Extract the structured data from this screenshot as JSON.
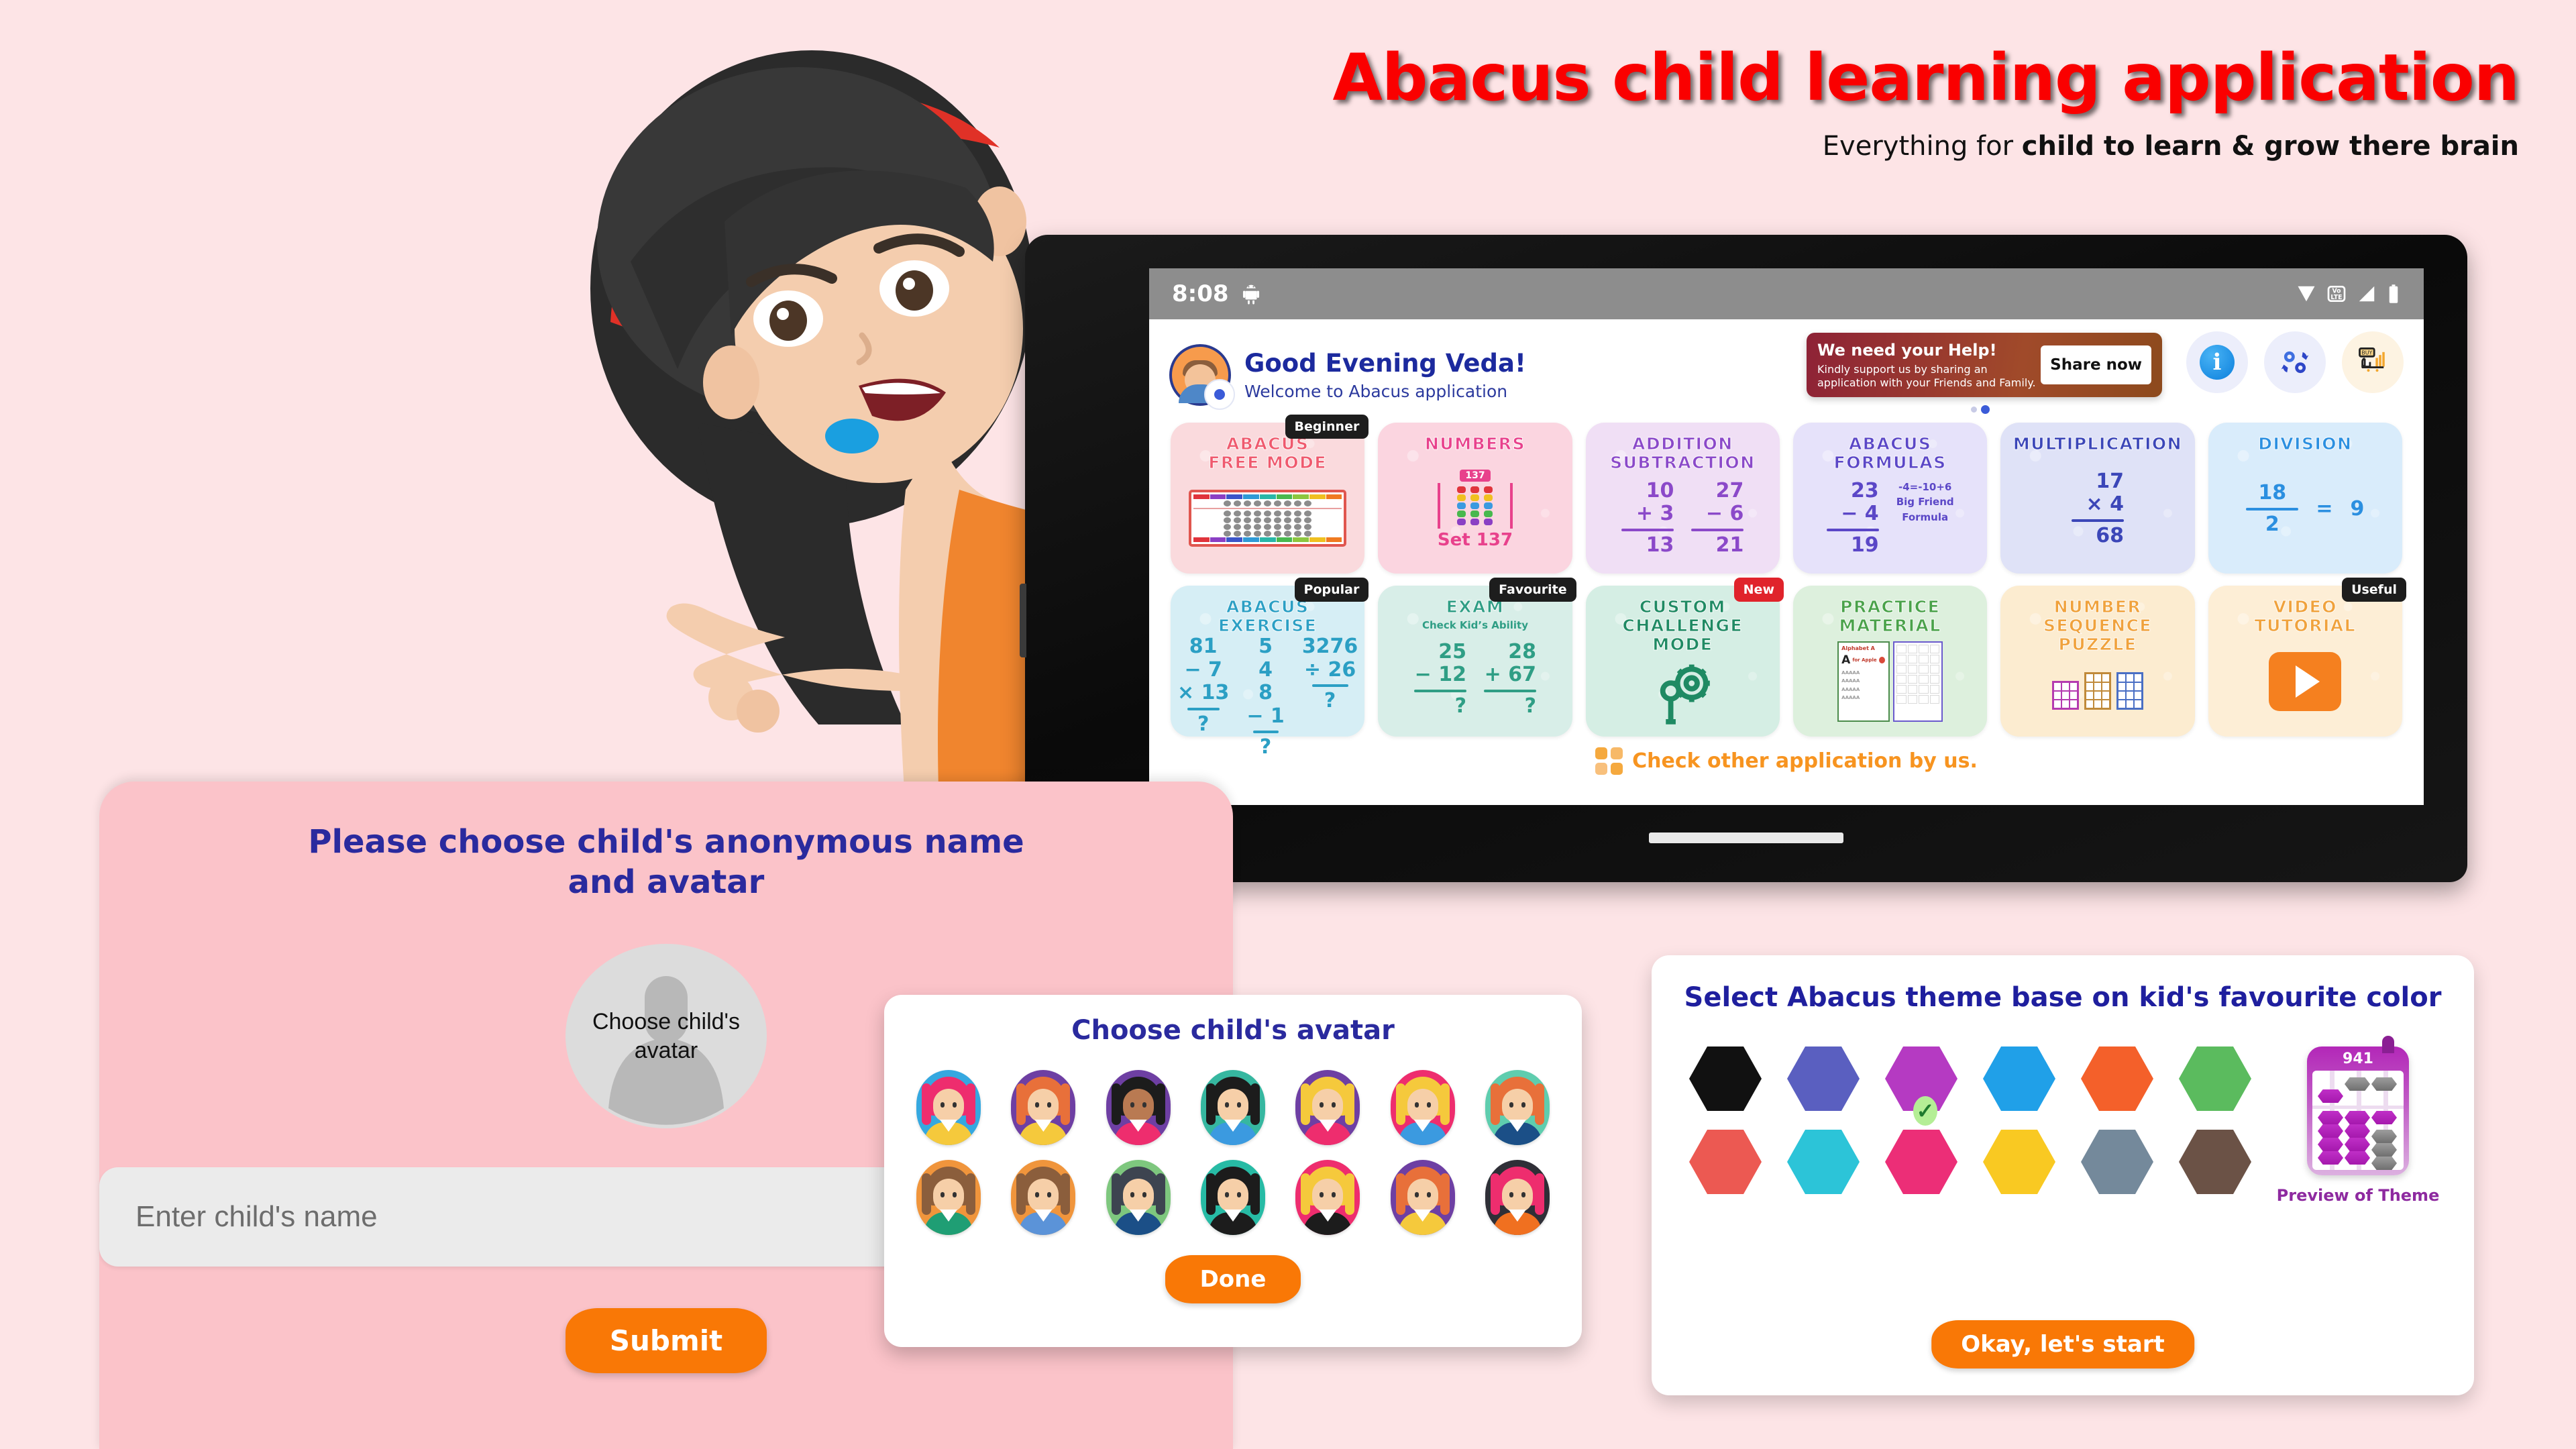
{
  "hero": {
    "title": "Abacus child learning application",
    "subtitle_plain": "Everything for ",
    "subtitle_bold": "child to learn & grow there brain"
  },
  "tablet": {
    "statusbar": {
      "time": "8:08",
      "icons": [
        "android-icon",
        "wifi-icon",
        "volte-icon",
        "signal-icon",
        "battery-icon"
      ]
    },
    "header": {
      "greeting": "Good Evening Veda!",
      "welcome": "Welcome to Abacus application",
      "help_banner": {
        "title": "We need your Help!",
        "body": "Kindly support us by sharing an application with your Friends and Family.",
        "button": "Share now"
      },
      "actions": [
        "info-icon",
        "settings-gears-icon",
        "buy-cart-icon"
      ]
    },
    "cards_row1": [
      {
        "title": "ABACUS\nFREE MODE",
        "badge": "Beginner",
        "bg": "#fadadd",
        "color": "#ef5a6e",
        "art": "abacus-illustration"
      },
      {
        "title": "NUMBERS",
        "badge": "",
        "bg": "#fbd5e0",
        "color": "#e8418c",
        "art": "number-abacus",
        "art_text": "137",
        "sub": "Set 137"
      },
      {
        "title": "ADDITION\nSUBTRACTION",
        "badge": "",
        "bg": "#f0dff5",
        "color": "#8b49c9",
        "art": "sum-pair",
        "sums": [
          {
            "a": "10",
            "op": "+",
            "b": "3",
            "r": "13"
          },
          {
            "a": "27",
            "op": "−",
            "b": "6",
            "r": "21"
          }
        ]
      },
      {
        "title": "ABACUS\nFORMULAS",
        "badge": "",
        "bg": "#e6e2fa",
        "color": "#5b47c7",
        "art": "formula",
        "sums": [
          {
            "a": "23",
            "op": "−",
            "b": "4",
            "r": "19"
          }
        ],
        "note1": "-4=-10+6",
        "note2": "Big Friend",
        "note3": "Formula"
      },
      {
        "title": "MULTIPLICATION",
        "badge": "",
        "bg": "#dfe2f7",
        "color": "#3b46b8",
        "art": "multiply",
        "sums": [
          {
            "a": "17",
            "op": "×",
            "b": "4",
            "r": "68"
          }
        ]
      },
      {
        "title": "DIVISION",
        "badge": "",
        "bg": "#d9ecfb",
        "color": "#2b8fe0",
        "art": "division",
        "fraction": {
          "num": "18",
          "den": "2",
          "eq": "=",
          "res": "9"
        }
      }
    ],
    "cards_row2": [
      {
        "title": "ABACUS\nEXERCISE",
        "badge": "Popular",
        "bg": "#d6eef5",
        "color": "#2b9fc4",
        "art": "exercise",
        "lines": [
          "5",
          "4",
          "81",
          "− 7",
          "× 13",
          "8",
          "− 1",
          "?",
          "3276",
          "÷ 26",
          "?"
        ]
      },
      {
        "title": "EXAM",
        "sub": "Check Kid’s Ability",
        "badge": "Favourite",
        "bg": "#d8eee8",
        "color": "#2f9e85",
        "art": "exam",
        "sums": [
          {
            "a": "25",
            "op": "−",
            "b": "12",
            "r": "?"
          },
          {
            "a": "28",
            "op": "+",
            "b": "67",
            "r": "?"
          }
        ]
      },
      {
        "title": "CUSTOM\nCHALLENGE\nMODE",
        "badge": "New",
        "badge_red": true,
        "bg": "#d5eee4",
        "color": "#1f8a63",
        "art": "gear-wrench-icon"
      },
      {
        "title": "PRACTICE\nMATERIAL",
        "badge": "",
        "bg": "#ddf0dd",
        "color": "#4aa24a",
        "art": "worksheets"
      },
      {
        "title": "NUMBER\nSEQUENCE\nPUZZLE",
        "badge": "",
        "bg": "#fcecd0",
        "color": "#f0a23c",
        "art": "grid-puzzles"
      },
      {
        "title": "VIDEO\nTUTORIAL",
        "badge": "Useful",
        "bg": "#fdeed6",
        "color": "#f0a23c",
        "art": "play-button-icon"
      }
    ],
    "footer_link": "Check other application by us."
  },
  "left_panel": {
    "title": "Please choose child's anonymous name and avatar",
    "avatar_placeholder": "Choose child's avatar",
    "name_placeholder": "Enter child's name",
    "name_value": "",
    "submit_label": "Submit"
  },
  "avatar_dialog": {
    "title": "Choose child's avatar",
    "done_label": "Done",
    "avatars": [
      {
        "bg": "#35a8e0",
        "hair": "#ee2d6e",
        "body": "#f5c93c",
        "side": "#ee2d6e"
      },
      {
        "bg": "#6e3fa3",
        "hair": "#e8703a",
        "body": "#f5c93c",
        "side": "#e8703a"
      },
      {
        "bg": "#6e3fa3",
        "hair": "#1c1c1c",
        "body": "#ee2d6e",
        "side": "#1c1c1c",
        "skin": "#b97a52"
      },
      {
        "bg": "#36b7a0",
        "hair": "#1c1c1c",
        "body": "#3b9ae0",
        "side": "#1c1c1c"
      },
      {
        "bg": "#6e3fa3",
        "hair": "#f5c93c",
        "body": "#ee2d6e",
        "side": "#f5c93c"
      },
      {
        "bg": "#ee2d6e",
        "hair": "#f5c93c",
        "body": "#3b9ae0",
        "side": "#f5c93c"
      },
      {
        "bg": "#5fcdae",
        "hair": "#e8703a",
        "body": "#1b4f87",
        "side": "#e8703a"
      },
      {
        "bg": "#f0953c",
        "hair": "#8b5e3c",
        "body": "#1f9e74",
        "side": "#8b5e3c"
      },
      {
        "bg": "#f0953c",
        "hair": "#8b5e3c",
        "body": "#5b93d8",
        "side": "#8b5e3c"
      },
      {
        "bg": "#7ec77e",
        "hair": "#3d4450",
        "body": "#1b4f87",
        "side": "#3d4450"
      },
      {
        "bg": "#27bba5",
        "hair": "#1c1c1c",
        "body": "#1c1c1c",
        "side": "#1c1c1c"
      },
      {
        "bg": "#ee2d6e",
        "hair": "#f5c93c",
        "body": "#1c1c1c",
        "side": "#f5c93c"
      },
      {
        "bg": "#6e3fa3",
        "hair": "#e8703a",
        "body": "#f5c93c",
        "side": "#e8703a"
      },
      {
        "bg": "#2f2f37",
        "hair": "#ee2d6e",
        "body": "#f07020",
        "side": "#ee2d6e"
      }
    ]
  },
  "theme_panel": {
    "title": "Select Abacus theme base on kid's favourite color",
    "start_label": "Okay, let's start",
    "preview_label": "Preview of Theme",
    "preview_number": "941",
    "selected_index": 2,
    "check_glyph": "✓",
    "colors": [
      "#111111",
      "#5a5fc0",
      "#b53ac2",
      "#20a0e8",
      "#f4602a",
      "#5bbb5e",
      "#ec5952",
      "#2cc4d8",
      "#ec2e77",
      "#f9c922",
      "#74899b",
      "#6b5246"
    ]
  }
}
